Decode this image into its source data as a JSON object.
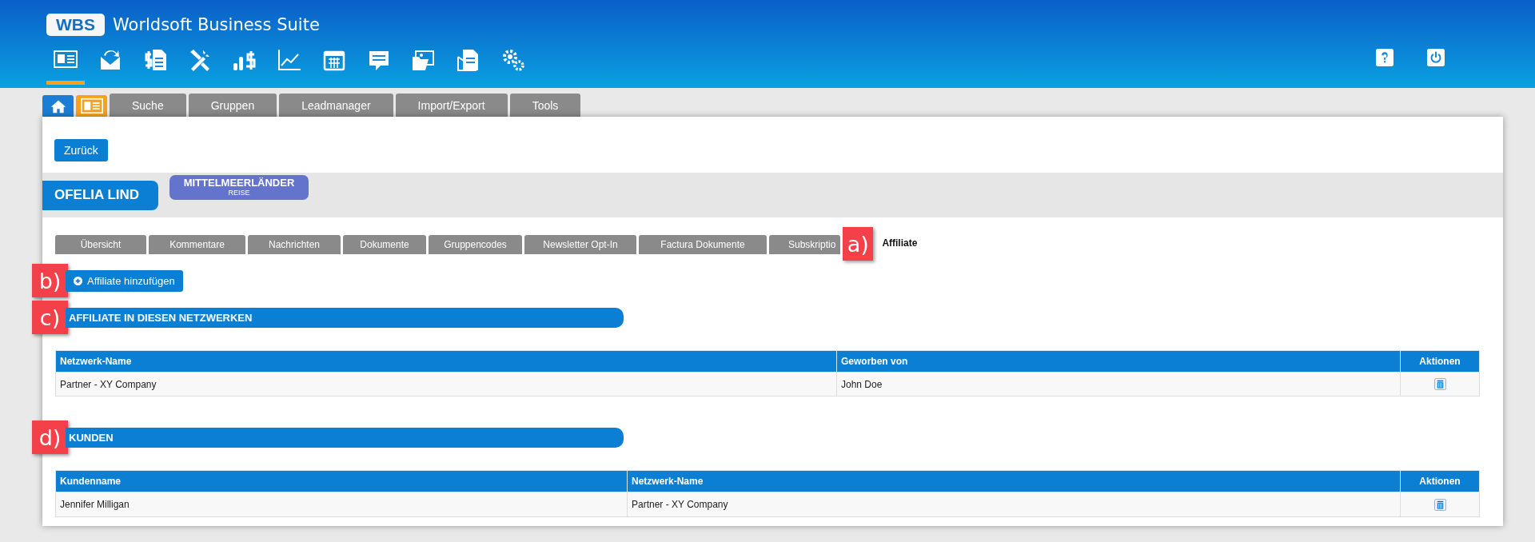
{
  "app": {
    "logo": "WBS",
    "title": "Worldsoft Business Suite"
  },
  "nav_icons": [
    {
      "selected": true
    },
    {
      "selected": false
    },
    {
      "selected": false
    },
    {
      "selected": false
    },
    {
      "selected": false
    },
    {
      "selected": false
    },
    {
      "selected": false
    },
    {
      "selected": false
    },
    {
      "selected": false
    },
    {
      "selected": false
    },
    {
      "selected": false
    }
  ],
  "icon_tabs": [
    {
      "selected": false
    },
    {
      "selected": true
    }
  ],
  "top_tabs": [
    {
      "label": "Suche",
      "selected": false
    },
    {
      "label": "Gruppen",
      "selected": false
    },
    {
      "label": "Leadmanager",
      "selected": false
    },
    {
      "label": "Import/Export",
      "selected": false
    },
    {
      "label": "Tools",
      "selected": false
    }
  ],
  "back_button": "Zurück",
  "contact": {
    "name": "OFELIA LIND",
    "group": "MITTELMEERLÄNDER",
    "group_sub": "REISE"
  },
  "sub_tabs": [
    {
      "label": "Übersicht",
      "selected": false
    },
    {
      "label": "Kommentare",
      "selected": false
    },
    {
      "label": "Nachrichten",
      "selected": false
    },
    {
      "label": "Dokumente",
      "selected": false
    },
    {
      "label": "Gruppencodes",
      "selected": false
    },
    {
      "label": "Newsletter Opt-In",
      "selected": false
    },
    {
      "label": "Factura Dokumente",
      "selected": false
    },
    {
      "label": "Subskriptio",
      "selected": false
    },
    {
      "label": "Affiliate",
      "selected": true
    }
  ],
  "sub_tabs_callout": "a)",
  "add_button": {
    "label": "Affiliate hinzufügen",
    "callout": "b)"
  },
  "sections": [
    {
      "title": "AFFILIATE IN DIESEN NETZWERKEN",
      "callout": "c)",
      "columns": [
        "Netzwerk-Name",
        "Geworben von",
        "Aktionen"
      ],
      "rows": [
        [
          "Partner - XY Company",
          "John Doe"
        ]
      ]
    },
    {
      "title": "KUNDEN",
      "callout": "d)",
      "columns": [
        "Kundenname",
        "Netzwerk-Name",
        "Aktionen"
      ],
      "rows": [
        [
          "Jennifer Milligan",
          "Partner - XY Company"
        ]
      ]
    }
  ]
}
